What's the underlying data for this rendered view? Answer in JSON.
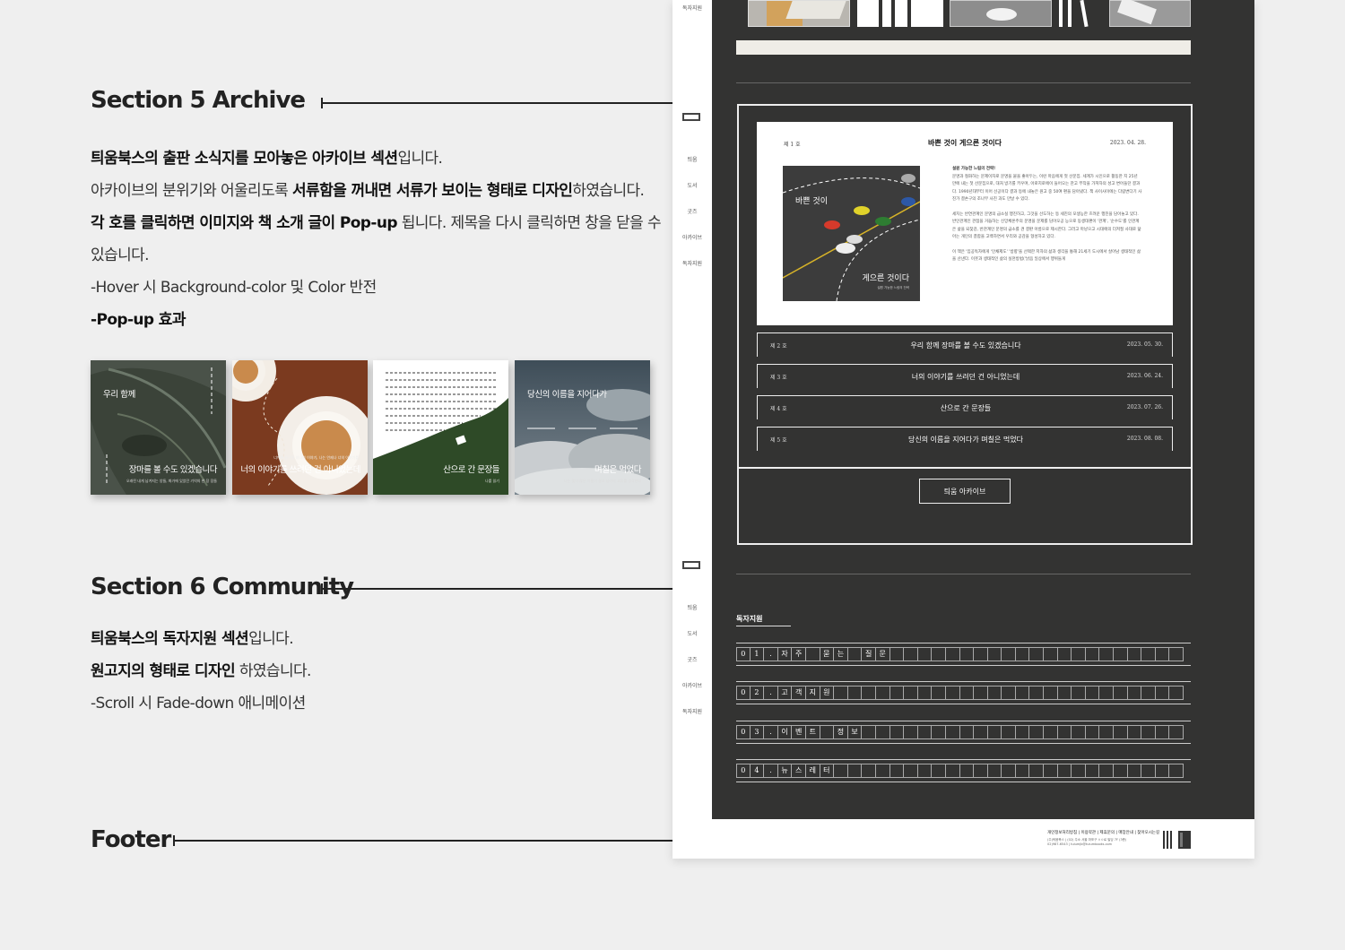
{
  "sections": [
    {
      "title": "Section 5  Archive",
      "lines": [
        [
          {
            "b": true,
            "t": "틔움북스의 출판 소식지를 모아놓은 아카이브 섹션"
          },
          {
            "b": false,
            "t": "입니다."
          }
        ],
        [
          {
            "b": false,
            "t": "아카이브의 분위기와 어울리도록 "
          },
          {
            "b": true,
            "t": "서류함을 꺼내면 서류가 보이는 형태로 디자인"
          },
          {
            "b": false,
            "t": "하였습니다."
          }
        ],
        [
          {
            "b": true,
            "t": "각 호를 클릭하면 이미지와 책 소개 글이 Pop-up"
          },
          {
            "b": false,
            "t": " 됩니다. 제목을 다시 클릭하면 창을 닫을 수"
          }
        ],
        [
          {
            "b": false,
            "t": "있습니다."
          }
        ],
        [
          {
            "b": false,
            "t": "-Hover 시 Background-color 및 Color 반전"
          }
        ],
        [
          {
            "b": true,
            "t": "-Pop-up 효과"
          }
        ]
      ]
    },
    {
      "title": "Section 6  Community",
      "lines": [
        [
          {
            "b": true,
            "t": "틔움북스의 독자지원 섹션"
          },
          {
            "b": false,
            "t": "입니다."
          }
        ],
        [
          {
            "b": true,
            "t": "원고지의 형태로 디자인"
          },
          {
            "b": false,
            "t": " 하였습니다."
          }
        ],
        [
          {
            "b": false,
            "t": "-Scroll 시 Fade-down 애니메이션"
          }
        ]
      ]
    },
    {
      "title": "Footer",
      "lines": []
    }
  ],
  "thumbnails": [
    {
      "top": "우리 함께",
      "main": "장마를 볼 수도 있겠습니다",
      "sub": "오래된 내게 남겨지는 양들, 화가에 있었던 기억의 한 장 장들",
      "color": "#4b554b"
    },
    {
      "top": "",
      "main": "너의 이야기를 쓰려던 건 아니었는데",
      "sub": "너에게 들려줄 하나의 이야기, 나는 언제나 너의 이야기를",
      "color": "#7c3a1f"
    },
    {
      "top": "",
      "main": "산으로 간 문장들",
      "sub": "나를 읽기",
      "color": "#2e4a27"
    },
    {
      "top": "당신의 이름을 지어다가",
      "main": "며칠은 먹었다",
      "sub": "나는 몇이 많은 이름이 결코 남이의 교류를 생각한다",
      "color": "#5a6770"
    }
  ],
  "page": {
    "top_nav_label": "독자지원",
    "nav_items": [
      "틔움",
      "도서",
      "굿즈",
      "아카이브",
      "독자지원"
    ],
    "archive": {
      "open_issue": {
        "no": "제 1 호",
        "title": "바쁜 것이 게으른 것이다",
        "date": "2023. 04. 28.",
        "image_label_1": "바쁜 것이",
        "image_label_2": "게으른 것이다",
        "image_label_3": "설원 가능한 느림의 전략",
        "body_lead": "설원 가능한 느림의 전략!",
        "body_1": "문명과 철화하는 문제이자로 문명을 붙을 좋아두는, 이런 마음에게 첫 산문집. 세계가 시인으로 활동한 지 25년 만에 내는 첫 산문집으로, 대처 방기를 키우며, 아로지로에이 들어오는 찬고 부작을 가져자의 성고 변어들던 결과다. 1990년대부터 이어 선공이다 결과 등에 내놓은 원고 중 50여 편을 담아냈다. 책 사이사이에는 다람변다기 사진가 결손구의 조나무 사진 과도 만날 수 있다.",
        "body_2": "세치는 반연관계인 문명의 급소실 행진하고, 그것을 선도하는 등 세진의 모생능한 흐려운 행진을 담아놓고 있다. 반인관계인 관점을 거듭하는 신앙체온주의 문명을 문제를 담아오공 능으로 동생대편이 '관계', '순수도'를 인관계은 삶을 되찾감, 반관계인 문명의 급소를 견 결판 아름으로 제시한다. 그러고 마냥으고 시대에의 더져질 사대로 닮아는 개인의 결합을 고백하면서 우리와 공감을 형성하고 있다.",
        "body_3": "이 책은 '임공독자에게 '인채제도' '방향'을 선택한 저자의 삶과 생각을 통해 21세기 도시에서 살아남 생태적인 삶을 산낸다. 이웃과 생태적인 삶의 실천방법('낡음 일상에서 행위들게"
      },
      "issues": [
        {
          "no": "제 2 호",
          "title": "우리 함께 장마를 볼 수도 있겠습니다",
          "date": "2023. 05. 30."
        },
        {
          "no": "제 3 호",
          "title": "너의 이야기를 쓰려던 건 아니었는데",
          "date": "2023. 06. 24."
        },
        {
          "no": "제 4 호",
          "title": "산으로 간 문장들",
          "date": "2023. 07. 26."
        },
        {
          "no": "제 5 호",
          "title": "당신의 이름을 지어다가 며칠은 먹었다",
          "date": "2023. 08. 08."
        }
      ],
      "button_label": "틔움 아카이브"
    },
    "community": {
      "title": "독자지원",
      "rows": [
        [
          "0",
          "1",
          ".",
          "자",
          "주",
          "",
          "묻",
          "는",
          "",
          "질",
          "문"
        ],
        [
          "0",
          "2",
          ".",
          "고",
          "객",
          "지",
          "원"
        ],
        [
          "0",
          "3",
          ".",
          "이",
          "벤",
          "트",
          "",
          "정",
          "보"
        ],
        [
          "0",
          "4",
          ".",
          "뉴",
          "스",
          "레",
          "터"
        ]
      ]
    },
    "footer": {
      "links": "개인정보처리방침 | 이용약관 | 제휴문의 | 매장안내 | 찾아오시는길",
      "info_1": "(주)틔움북스 | (02) 주소 서울 마포구 ㅇㅇ로 빌딩 7F (3층)",
      "info_2": "02)987-6543 | tuiumjb@tuiumbooks.com"
    }
  }
}
